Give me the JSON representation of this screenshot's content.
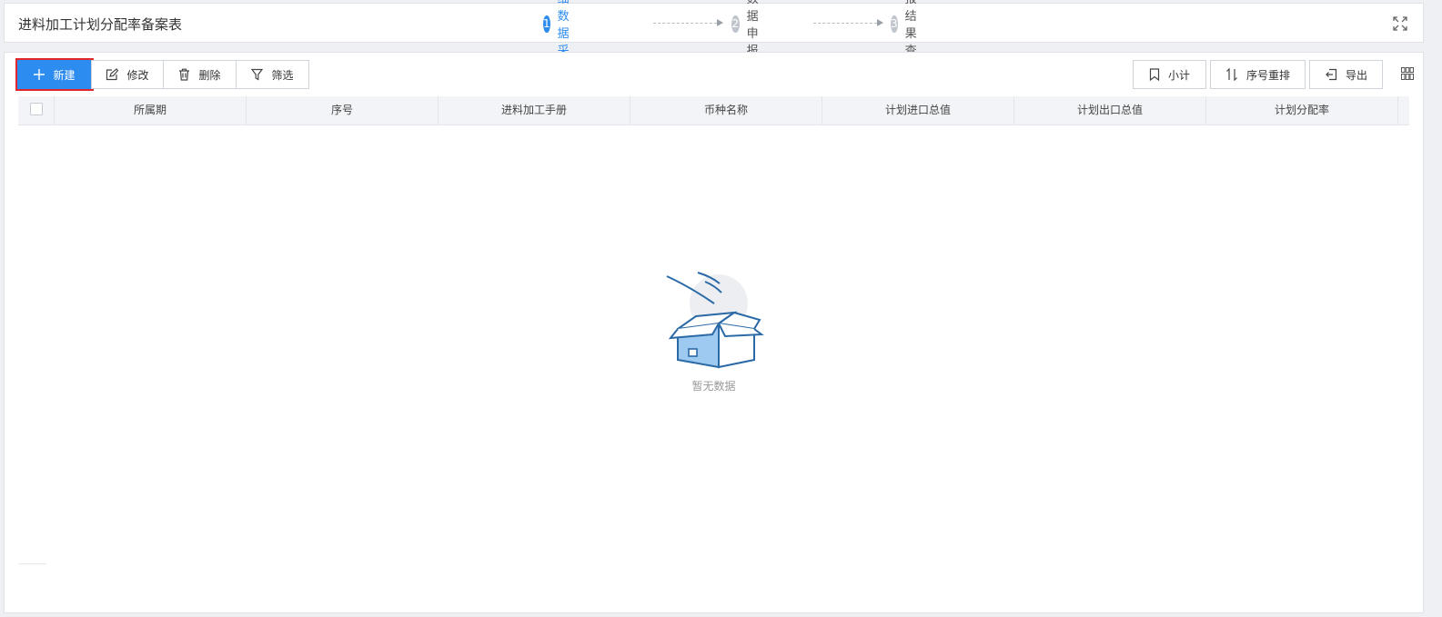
{
  "header": {
    "title": "进料加工计划分配率备案表",
    "steps": [
      {
        "num": "1",
        "label": "明细数据采集",
        "active": true
      },
      {
        "num": "2",
        "label": "数据申报",
        "active": false
      },
      {
        "num": "3",
        "label": "申报结果查询",
        "active": false
      }
    ],
    "fullscreen_icon": "expand-icon"
  },
  "toolbar": {
    "new_label": "新建",
    "edit_label": "修改",
    "delete_label": "删除",
    "filter_label": "筛选",
    "subtotal_label": "小计",
    "reorder_label": "序号重排",
    "export_label": "导出"
  },
  "table": {
    "columns": [
      "所属期",
      "序号",
      "进料加工手册",
      "币种名称",
      "计划进口总值",
      "计划出口总值",
      "计划分配率"
    ],
    "rows": []
  },
  "empty_state": {
    "text": "暂无数据"
  },
  "colors": {
    "accent": "#2d8cf0",
    "highlight_border": "#e0262a"
  }
}
